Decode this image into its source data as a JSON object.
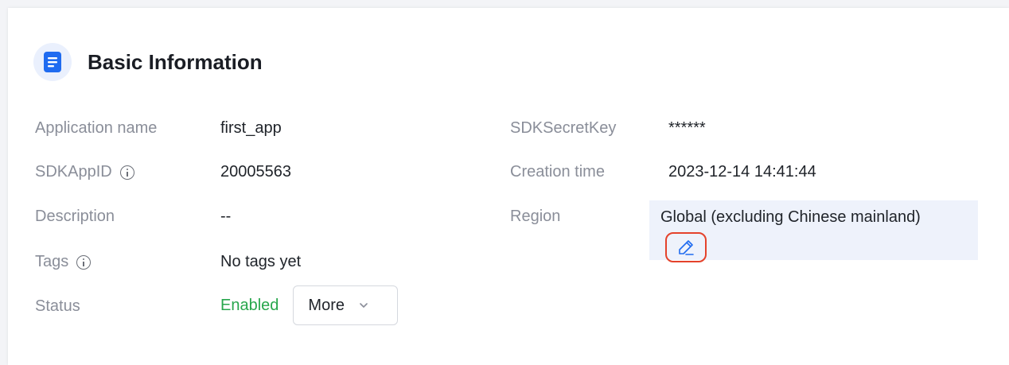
{
  "section": {
    "title": "Basic Information",
    "icon": "document-icon",
    "accent": "#1f6bf0"
  },
  "fields": {
    "app_name": {
      "label": "Application name",
      "value": "first_app"
    },
    "sdkappid": {
      "label": "SDKAppID",
      "value": "20005563",
      "icon": "info-icon"
    },
    "description": {
      "label": "Description",
      "value": "--"
    },
    "tags": {
      "label": "Tags",
      "value": "No tags yet",
      "icon": "info-icon"
    },
    "status": {
      "label": "Status",
      "value": "Enabled",
      "color": "#27a64c"
    },
    "more_button": {
      "label": "More",
      "icon": "chevron-down-icon"
    },
    "secret_key": {
      "label": "SDKSecretKey",
      "value": "******"
    },
    "creation_time": {
      "label": "Creation time",
      "value": "2023-12-14 14:41:44"
    },
    "region": {
      "label": "Region",
      "value": "Global (excluding Chinese mainland)",
      "edit_icon": "pencil-icon",
      "highlight": "#e4422b"
    }
  }
}
